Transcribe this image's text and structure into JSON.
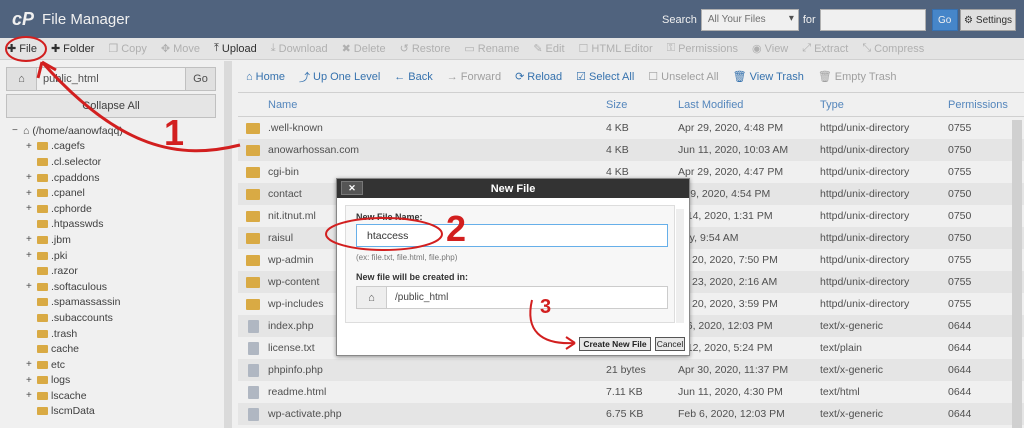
{
  "header": {
    "title": "File Manager",
    "search_label": "Search",
    "search_scope": "All Your Files",
    "for_label": "for",
    "go_label": "Go",
    "settings_label": "Settings"
  },
  "toolbar": [
    {
      "label": "File",
      "icon": "plus-icon",
      "enabled": true
    },
    {
      "label": "Folder",
      "icon": "plus-icon",
      "enabled": true
    },
    {
      "label": "Copy",
      "icon": "copy-icon",
      "enabled": false
    },
    {
      "label": "Move",
      "icon": "move-icon",
      "enabled": false
    },
    {
      "label": "Upload",
      "icon": "upload-icon",
      "enabled": true
    },
    {
      "label": "Download",
      "icon": "download-icon",
      "enabled": false
    },
    {
      "label": "Delete",
      "icon": "close-icon",
      "enabled": false
    },
    {
      "label": "Restore",
      "icon": "restore-icon",
      "enabled": false
    },
    {
      "label": "Rename",
      "icon": "rename-icon",
      "enabled": false
    },
    {
      "label": "Edit",
      "icon": "pencil-icon",
      "enabled": false
    },
    {
      "label": "HTML Editor",
      "icon": "html-editor-icon",
      "enabled": false
    },
    {
      "label": "Permissions",
      "icon": "key-icon",
      "enabled": false
    },
    {
      "label": "View",
      "icon": "eye-icon",
      "enabled": false
    },
    {
      "label": "Extract",
      "icon": "extract-icon",
      "enabled": false
    },
    {
      "label": "Compress",
      "icon": "compress-icon",
      "enabled": false
    }
  ],
  "left": {
    "path_value": "public_html",
    "go_label": "Go",
    "collapse_label": "Collapse All",
    "root_label": "(/home/aanowfaqq)",
    "tree": [
      {
        "name": ".cagefs",
        "expand": true
      },
      {
        "name": ".cl.selector",
        "expand": false
      },
      {
        "name": ".cpaddons",
        "expand": true
      },
      {
        "name": ".cpanel",
        "expand": true
      },
      {
        "name": ".cphorde",
        "expand": true
      },
      {
        "name": ".htpasswds",
        "expand": false
      },
      {
        "name": ".jbm",
        "expand": true
      },
      {
        "name": ".pki",
        "expand": true
      },
      {
        "name": ".razor",
        "expand": false
      },
      {
        "name": ".softaculous",
        "expand": true
      },
      {
        "name": ".spamassassin",
        "expand": false
      },
      {
        "name": ".subaccounts",
        "expand": false
      },
      {
        "name": ".trash",
        "expand": false
      },
      {
        "name": "cache",
        "expand": false
      },
      {
        "name": "etc",
        "expand": true
      },
      {
        "name": "logs",
        "expand": true
      },
      {
        "name": "lscache",
        "expand": true
      },
      {
        "name": "lscmData",
        "expand": false
      }
    ]
  },
  "nav": [
    {
      "label": "Home",
      "enabled": true
    },
    {
      "label": "Up One Level",
      "enabled": true
    },
    {
      "label": "Back",
      "enabled": true
    },
    {
      "label": "Forward",
      "enabled": false
    },
    {
      "label": "Reload",
      "enabled": true
    },
    {
      "label": "Select All",
      "enabled": true
    },
    {
      "label": "Unselect All",
      "enabled": false
    },
    {
      "label": "View Trash",
      "enabled": true
    },
    {
      "label": "Empty Trash",
      "enabled": false
    }
  ],
  "columns": [
    "Name",
    "Size",
    "Last Modified",
    "Type",
    "Permissions"
  ],
  "files": [
    {
      "name": ".well-known",
      "size": "4 KB",
      "modified": "Apr 29, 2020, 4:48 PM",
      "type": "httpd/unix-directory",
      "perm": "0755",
      "kind": "folder"
    },
    {
      "name": "anowarhossan.com",
      "size": "4 KB",
      "modified": "Jun 11, 2020, 10:03 AM",
      "type": "httpd/unix-directory",
      "perm": "0750",
      "kind": "folder"
    },
    {
      "name": "cgi-bin",
      "size": "4 KB",
      "modified": "Apr 29, 2020, 4:47 PM",
      "type": "httpd/unix-directory",
      "perm": "0755",
      "kind": "folder"
    },
    {
      "name": "contact",
      "size": "",
      "modified": "r 29, 2020, 4:54 PM",
      "type": "httpd/unix-directory",
      "perm": "0750",
      "kind": "folder"
    },
    {
      "name": "nit.itnut.ml",
      "size": "",
      "modified": "n 14, 2020, 1:31 PM",
      "type": "httpd/unix-directory",
      "perm": "0750",
      "kind": "folder"
    },
    {
      "name": "raisul",
      "size": "",
      "modified": "day, 9:54 AM",
      "type": "httpd/unix-directory",
      "perm": "0750",
      "kind": "folder"
    },
    {
      "name": "wp-admin",
      "size": "",
      "modified": "ay 20, 2020, 7:50 PM",
      "type": "httpd/unix-directory",
      "perm": "0755",
      "kind": "folder"
    },
    {
      "name": "wp-content",
      "size": "",
      "modified": "ay 23, 2020, 2:16 AM",
      "type": "httpd/unix-directory",
      "perm": "0755",
      "kind": "folder"
    },
    {
      "name": "wp-includes",
      "size": "",
      "modified": "ay 20, 2020, 3:59 PM",
      "type": "httpd/unix-directory",
      "perm": "0755",
      "kind": "folder"
    },
    {
      "name": "index.php",
      "size": "",
      "modified": "b 6, 2020, 12:03 PM",
      "type": "text/x-generic",
      "perm": "0644",
      "kind": "doc"
    },
    {
      "name": "license.txt",
      "size": "",
      "modified": "b 12, 2020, 5:24 PM",
      "type": "text/plain",
      "perm": "0644",
      "kind": "doc"
    },
    {
      "name": "phpinfo.php",
      "size": "21 bytes",
      "modified": "Apr 30, 2020, 11:37 PM",
      "type": "text/x-generic",
      "perm": "0644",
      "kind": "doc"
    },
    {
      "name": "readme.html",
      "size": "7.11 KB",
      "modified": "Jun 11, 2020, 4:30 PM",
      "type": "text/html",
      "perm": "0644",
      "kind": "doc"
    },
    {
      "name": "wp-activate.php",
      "size": "6.75 KB",
      "modified": "Feb 6, 2020, 12:03 PM",
      "type": "text/x-generic",
      "perm": "0644",
      "kind": "doc"
    }
  ],
  "dialog": {
    "title": "New File",
    "close_label": "✕",
    "name_label": "New File Name:",
    "name_value": "htaccess",
    "hint": "(ex: file.txt, file.html, file.php)",
    "location_label": "New file will be created in:",
    "location_value": "/public_html",
    "create_label": "Create New File",
    "cancel_label": "Cancel"
  },
  "annotations": {
    "one": "1",
    "two": "2",
    "three": "3"
  },
  "colors": {
    "header": "#566a86",
    "link": "#3a7ab9",
    "annotation": "#d21f1f",
    "folder": "#e7b549"
  }
}
